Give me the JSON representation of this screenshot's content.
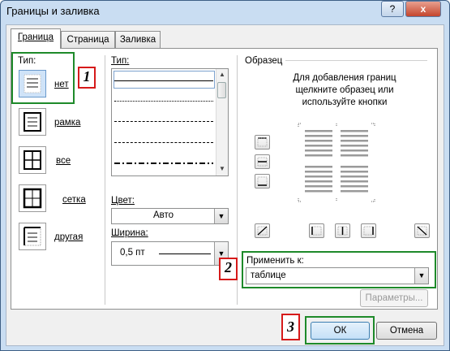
{
  "window": {
    "title": "Границы и заливка",
    "help_glyph": "?",
    "close_glyph": "x"
  },
  "tabs": [
    {
      "label": "Граница",
      "active": true
    },
    {
      "label": "Страница",
      "active": false
    },
    {
      "label": "Заливка",
      "active": false
    }
  ],
  "setting": {
    "label": "Тип:",
    "items": [
      {
        "label": "нет",
        "icon": "border-none-icon",
        "selected": true
      },
      {
        "label": "рамка",
        "icon": "border-box-icon",
        "selected": false
      },
      {
        "label": "все",
        "icon": "border-all-icon",
        "selected": false
      },
      {
        "label": "сетка",
        "icon": "border-grid-icon",
        "selected": false
      },
      {
        "label": "другая",
        "icon": "border-custom-icon",
        "selected": false
      }
    ]
  },
  "style": {
    "label": "Тип:",
    "options": [
      "solid",
      "dotted",
      "dashed",
      "dashed-long",
      "dash-dot"
    ],
    "selected_index": 0
  },
  "color": {
    "label": "Цвет:",
    "value": "Авто"
  },
  "width": {
    "label": "Ширина:",
    "value": "0,5 пт"
  },
  "preview": {
    "label": "Образец",
    "hint_lines": [
      "Для добавления границ",
      "щелкните образец или",
      "используйте кнопки"
    ]
  },
  "apply_to": {
    "label": "Применить к:",
    "value": "таблице"
  },
  "buttons": {
    "options": "Параметры...",
    "ok": "ОК",
    "cancel": "Отмена"
  },
  "annotations": [
    "1",
    "2",
    "3"
  ],
  "colors": {
    "highlight_green": "#1e8a2a",
    "marker_red": "#d61a1a",
    "selection_blue": "#cfe3f8"
  }
}
